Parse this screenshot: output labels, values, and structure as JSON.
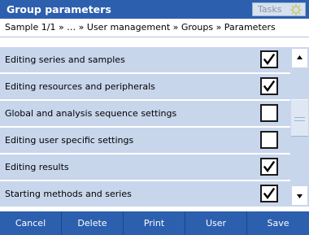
{
  "header": {
    "title": "Group parameters",
    "tasks_label": "Tasks",
    "tasks_icon": "gear-icon"
  },
  "breadcrumb": {
    "text": "Sample 1/1 » … » User management » Groups » Parameters"
  },
  "list": {
    "items": [
      {
        "label": "Editing series and samples",
        "checked": true
      },
      {
        "label": "Editing resources and peripherals",
        "checked": true
      },
      {
        "label": "Global and analysis sequence settings",
        "checked": false
      },
      {
        "label": "Editing user specific settings",
        "checked": false
      },
      {
        "label": "Editing results",
        "checked": true
      },
      {
        "label": "Starting methods and series",
        "checked": true
      }
    ]
  },
  "scrollbar": {
    "up_icon": "arrow-up-icon",
    "down_icon": "arrow-down-icon"
  },
  "footer": {
    "buttons": [
      "Cancel",
      "Delete",
      "Print",
      "User",
      "Save"
    ]
  },
  "colors": {
    "header_bg": "#2c5fae",
    "row_bg": "#c8d6ec",
    "footer_bg": "#2c5fae"
  }
}
